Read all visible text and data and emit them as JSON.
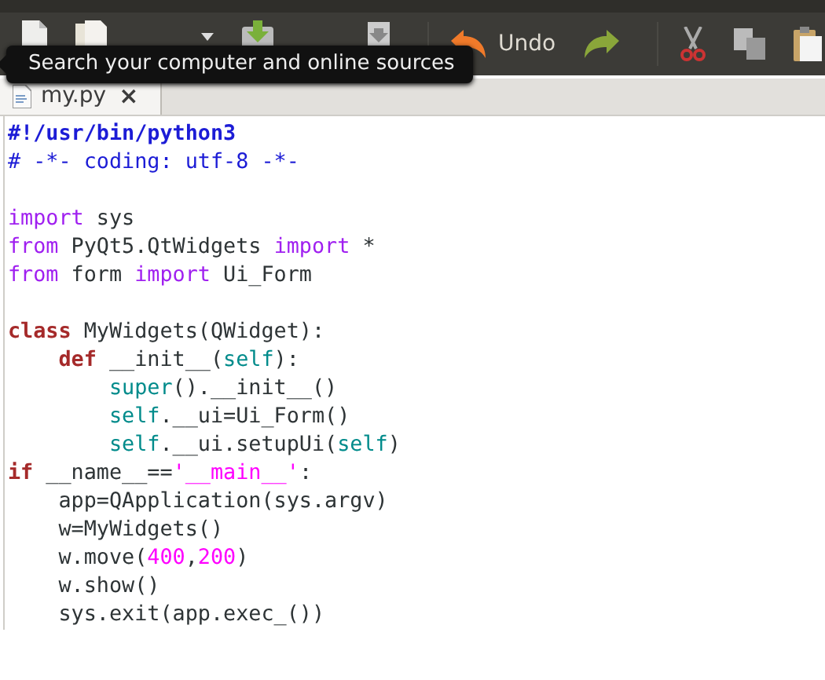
{
  "toolbar": {
    "buttons": [
      {
        "kind": "new"
      },
      {
        "kind": "open"
      },
      {
        "kind": "dropdown"
      },
      {
        "kind": "save"
      },
      {
        "kind": "print"
      },
      {
        "kind": "undo",
        "label": "Undo"
      },
      {
        "kind": "redo"
      },
      {
        "kind": "cut"
      },
      {
        "kind": "copy"
      },
      {
        "kind": "paste"
      }
    ]
  },
  "tooltip": {
    "text": "Search your computer and online sources"
  },
  "tabs": [
    {
      "label": "my.py",
      "close": "×",
      "selected": true
    }
  ],
  "code": [
    {
      "tokens": [
        {
          "kind": "shebang",
          "text": "#!/usr/bin/python3"
        }
      ]
    },
    {
      "tokens": [
        {
          "kind": "comment",
          "text": "# -*- coding: utf-8 -*-"
        }
      ],
      "blank_after": true
    },
    {
      "tokens": [
        {
          "kind": "keyword",
          "text": "import"
        },
        {
          "kind": "plain",
          "text": " sys"
        }
      ]
    },
    {
      "tokens": [
        {
          "kind": "keyword",
          "text": "from"
        },
        {
          "kind": "plain",
          "text": " PyQt5.QtWidgets "
        },
        {
          "kind": "keyword",
          "text": "import"
        },
        {
          "kind": "plain",
          "text": " *"
        }
      ]
    },
    {
      "tokens": [
        {
          "kind": "keyword",
          "text": "from"
        },
        {
          "kind": "plain",
          "text": " form "
        },
        {
          "kind": "keyword",
          "text": "import"
        },
        {
          "kind": "plain",
          "text": " Ui_Form"
        }
      ],
      "blank_after": true
    },
    {
      "tokens": [
        {
          "kind": "statement",
          "text": "class"
        },
        {
          "kind": "plain",
          "text": " MyWidgets(QWidget):"
        }
      ],
      "children": [
        {
          "tokens": [
            {
              "kind": "statement",
              "text": "def"
            },
            {
              "kind": "plain",
              "text": " __init__("
            },
            {
              "kind": "builtin",
              "text": "self"
            },
            {
              "kind": "plain",
              "text": "):"
            }
          ],
          "children": [
            {
              "tokens": [
                {
                  "kind": "builtin",
                  "text": "super"
                },
                {
                  "kind": "plain",
                  "text": "().__init__()"
                }
              ]
            },
            {
              "tokens": [
                {
                  "kind": "builtin",
                  "text": "self"
                },
                {
                  "kind": "plain",
                  "text": ".__ui=Ui_Form()"
                }
              ]
            },
            {
              "tokens": [
                {
                  "kind": "builtin",
                  "text": "self"
                },
                {
                  "kind": "plain",
                  "text": ".__ui.setupUi("
                },
                {
                  "kind": "builtin",
                  "text": "self"
                },
                {
                  "kind": "plain",
                  "text": ")"
                }
              ]
            }
          ]
        }
      ]
    },
    {
      "tokens": [
        {
          "kind": "statement",
          "text": "if"
        },
        {
          "kind": "plain",
          "text": " __name__=="
        },
        {
          "kind": "string",
          "text": "'__main__'"
        },
        {
          "kind": "plain",
          "text": ":"
        }
      ],
      "children": [
        {
          "tokens": [
            {
              "kind": "plain",
              "text": "app=QApplication(sys.argv)"
            }
          ]
        },
        {
          "tokens": [
            {
              "kind": "plain",
              "text": "w=MyWidgets()"
            }
          ]
        },
        {
          "tokens": [
            {
              "kind": "plain",
              "text": "w.move("
            },
            {
              "kind": "number",
              "text": "400"
            },
            {
              "kind": "plain",
              "text": ","
            },
            {
              "kind": "number",
              "text": "200"
            },
            {
              "kind": "plain",
              "text": ")"
            }
          ]
        },
        {
          "tokens": [
            {
              "kind": "plain",
              "text": "w.show()"
            }
          ]
        },
        {
          "tokens": [
            {
              "kind": "plain",
              "text": "sys.exit(app.exec_())"
            }
          ]
        }
      ]
    }
  ]
}
